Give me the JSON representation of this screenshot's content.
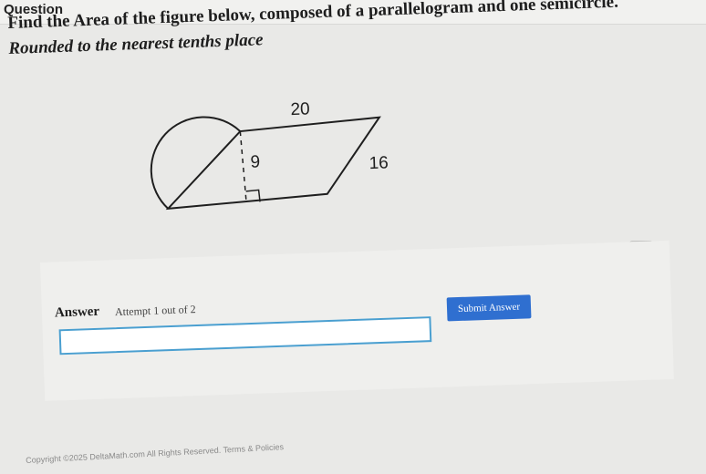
{
  "header": {
    "title": "Question"
  },
  "question": {
    "prompt": "Find the Area of the figure below, composed of a parallelogram and one semicircle.",
    "instruction": "Rounded to the nearest tenths place"
  },
  "figure": {
    "top_label": "20",
    "height_label": "9",
    "slant_label": "16"
  },
  "answer": {
    "label": "Answer",
    "attempt": "Attempt 1 out of 2",
    "input_value": "",
    "submit_label": "Submit Answer"
  },
  "footer": {
    "copyright": "Copyright ©2025 DeltaMath.com All Rights Reserved. Terms & Policies"
  },
  "icons": {
    "keyboard": "keyboard-icon"
  },
  "colors": {
    "submit": "#2f6fd0",
    "input_border": "#4a9fd0"
  }
}
